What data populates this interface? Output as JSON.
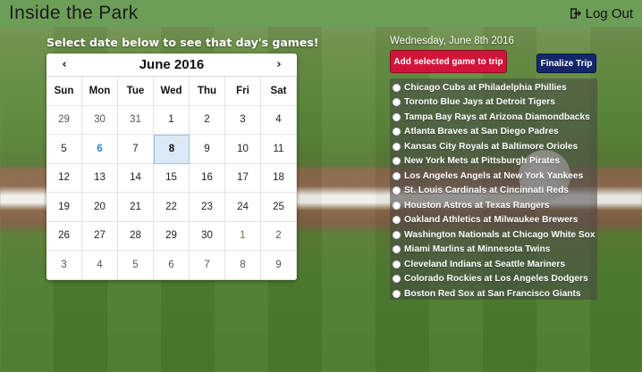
{
  "header": {
    "title": "Inside the Park",
    "logout_label": "Log Out"
  },
  "left": {
    "instruction": "Select date below to see that day's games!"
  },
  "calendar": {
    "month_label": "June 2016",
    "prev_label": "‹",
    "next_label": "›",
    "weekdays": [
      "Sun",
      "Mon",
      "Tue",
      "Wed",
      "Thu",
      "Fri",
      "Sat"
    ],
    "weeks": [
      [
        "29",
        "30",
        "31",
        "1",
        "2",
        "3",
        "4"
      ],
      [
        "5",
        "6",
        "7",
        "8",
        "9",
        "10",
        "11"
      ],
      [
        "12",
        "13",
        "14",
        "15",
        "16",
        "17",
        "18"
      ],
      [
        "19",
        "20",
        "21",
        "22",
        "23",
        "24",
        "25"
      ],
      [
        "26",
        "27",
        "28",
        "29",
        "30",
        "1",
        "2"
      ],
      [
        "3",
        "4",
        "5",
        "6",
        "7",
        "8",
        "9"
      ]
    ],
    "today": "6",
    "selected": "8"
  },
  "right": {
    "date_label": "Wednesday, June 8th 2016",
    "add_button": "Add selected game to trip",
    "finalize_button": "Finalize Trip",
    "games": [
      "Chicago Cubs at Philadelphia Phillies",
      "Toronto Blue Jays at Detroit Tigers",
      "Tampa Bay Rays at Arizona Diamondbacks",
      "Atlanta Braves at San Diego Padres",
      "Kansas City Royals at Baltimore Orioles",
      "New York Mets at Pittsburgh Pirates",
      "Los Angeles Angels at New York Yankees",
      "St. Louis Cardinals at Cincinnati Reds",
      "Houston Astros at Texas Rangers",
      "Oakland Athletics at Milwaukee Brewers",
      "Washington Nationals at Chicago White Sox",
      "Miami Marlins at Minnesota Twins",
      "Cleveland Indians at Seattle Mariners",
      "Colorado Rockies at Los Angeles Dodgers",
      "Boston Red Sox at San Francisco Giants"
    ]
  },
  "colors": {
    "header_bg": "#6d9e58",
    "add_button_bg": "#d3143a",
    "finalize_button_bg": "#14276b",
    "today_text": "#2a86c7",
    "selected_bg": "#dbe9f7"
  }
}
